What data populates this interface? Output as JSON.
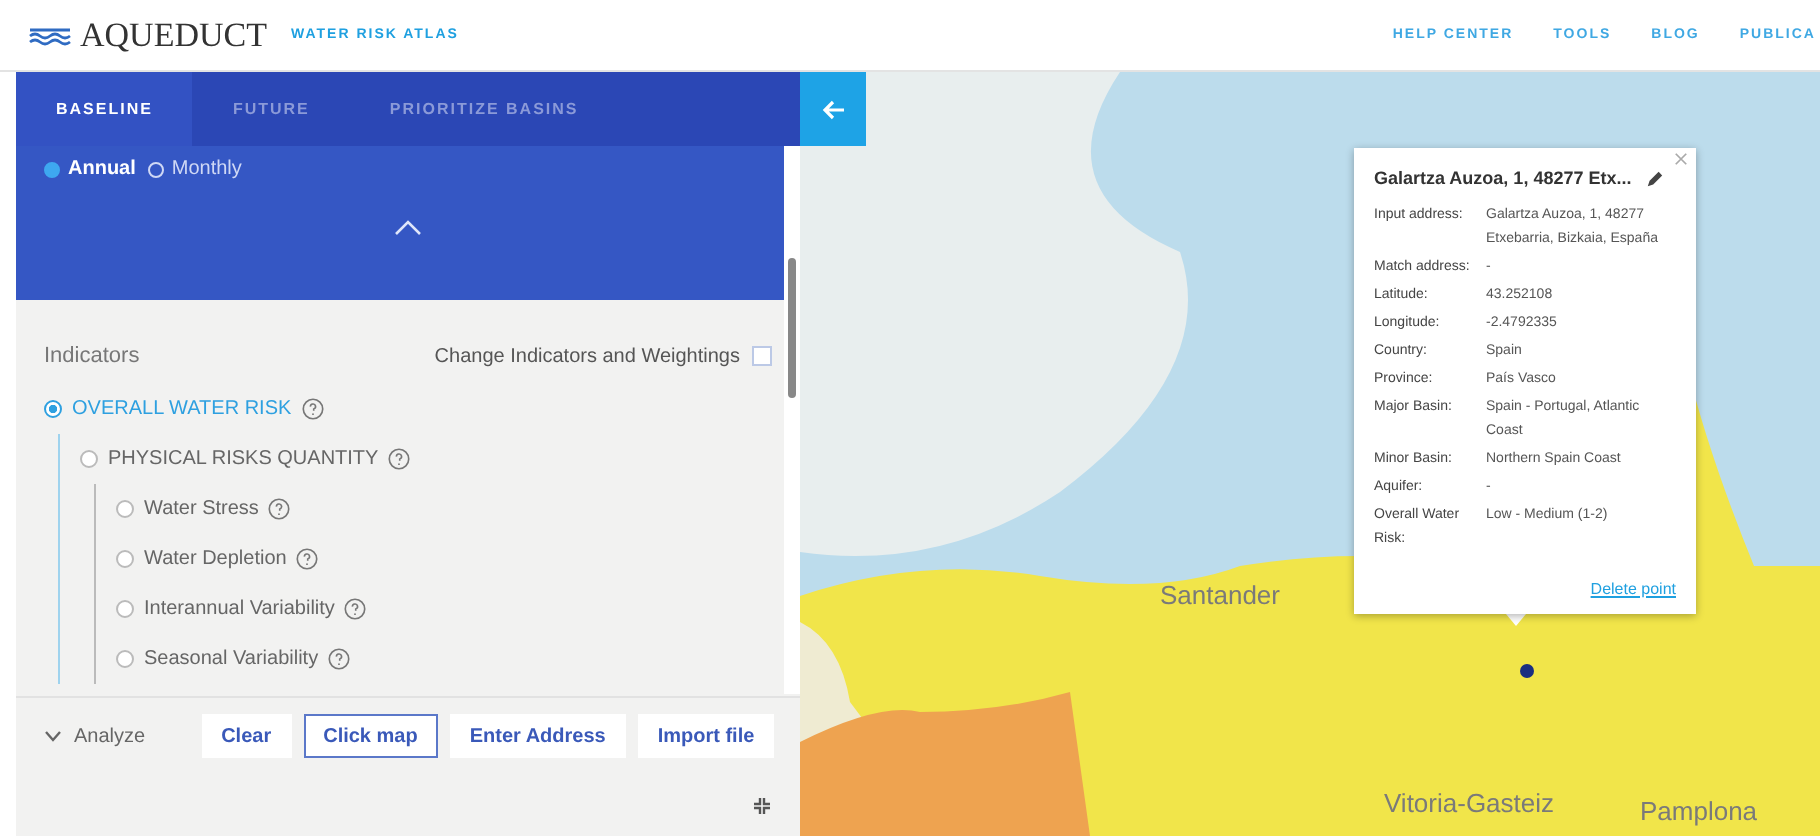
{
  "header": {
    "logo": "AQUEDUCT",
    "subtitle": "WATER RISK ATLAS",
    "nav": [
      "HELP CENTER",
      "TOOLS",
      "BLOG",
      "PUBLICA"
    ]
  },
  "tabs": [
    {
      "label": "BASELINE",
      "selected": true
    },
    {
      "label": "FUTURE",
      "selected": false
    },
    {
      "label": "PRIORITIZE BASINS",
      "selected": false
    }
  ],
  "timescale": [
    {
      "label": "Annual",
      "selected": true
    },
    {
      "label": "Monthly",
      "selected": false
    }
  ],
  "indicators": {
    "title": "Indicators",
    "change_label": "Change Indicators and Weightings",
    "change_checked": false,
    "items": [
      {
        "label": "OVERALL WATER RISK",
        "selected": true,
        "children": [
          {
            "label": "PHYSICAL RISKS QUANTITY",
            "selected": false,
            "children": [
              {
                "label": "Water Stress",
                "selected": false
              },
              {
                "label": "Water Depletion",
                "selected": false
              },
              {
                "label": "Interannual Variability",
                "selected": false
              },
              {
                "label": "Seasonal Variability",
                "selected": false
              }
            ]
          }
        ]
      }
    ]
  },
  "analyze": {
    "label": "Analyze",
    "buttons": [
      {
        "label": "Clear",
        "selected": false
      },
      {
        "label": "Click map",
        "selected": true
      },
      {
        "label": "Enter Address",
        "selected": false
      },
      {
        "label": "Import file",
        "selected": false
      }
    ]
  },
  "map": {
    "labels": [
      "Santander",
      "Vitoria-Gasteiz",
      "Pamplona"
    ]
  },
  "popup": {
    "title": "Galartza Auzoa, 1, 48277 Etx...",
    "fields": [
      {
        "label": "Input address:",
        "value": "Galartza Auzoa, 1, 48277 Etxebarria, Bizkaia, España"
      },
      {
        "label": "Match address:",
        "value": "-"
      },
      {
        "label": "Latitude:",
        "value": "43.252108"
      },
      {
        "label": "Longitude:",
        "value": "-2.4792335"
      },
      {
        "label": "Country:",
        "value": "Spain"
      },
      {
        "label": "Province:",
        "value": "País Vasco"
      },
      {
        "label": "Major Basin:",
        "value": "Spain - Portugal, Atlantic Coast"
      },
      {
        "label": "Minor Basin:",
        "value": "Northern Spain Coast"
      },
      {
        "label": "Aquifer:",
        "value": "-"
      },
      {
        "label": "Overall Water Risk:",
        "value": "Low - Medium (1-2)"
      }
    ],
    "link": "Delete point"
  }
}
